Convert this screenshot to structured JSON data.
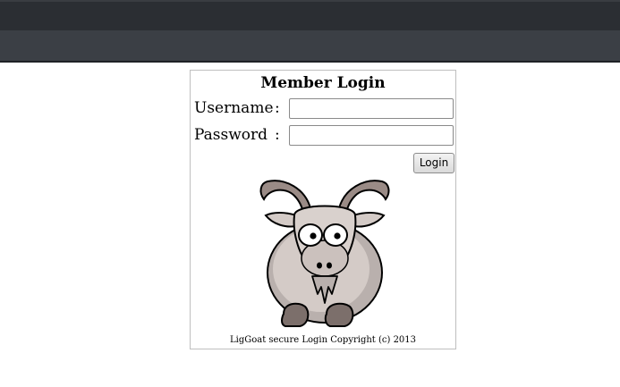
{
  "login": {
    "title": "Member Login",
    "username_label": "Username",
    "password_label": "Password",
    "colon": ":",
    "username_value": "",
    "password_value": "",
    "button_label": "Login",
    "logo_icon": "goat-icon",
    "copyright": "LigGoat secure Login Copyright (c) 2013"
  }
}
